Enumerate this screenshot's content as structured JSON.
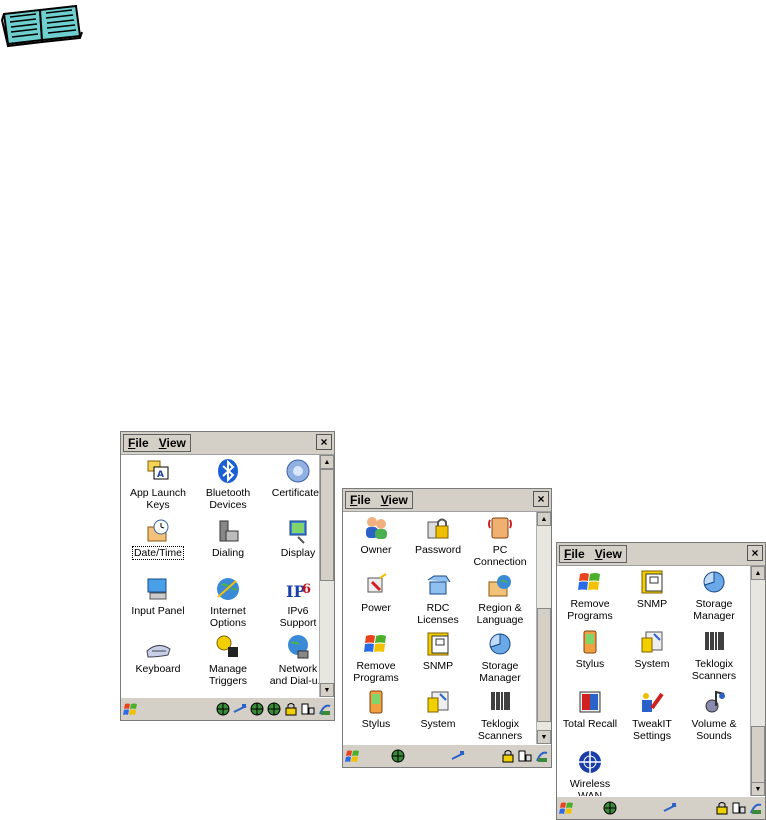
{
  "windows": [
    {
      "menu": {
        "file": "File",
        "view": "View"
      },
      "close": "×",
      "icons": [
        {
          "label": "App Launch\nKeys",
          "icon": "app-launch-keys-icon"
        },
        {
          "label": "Bluetooth\nDevices",
          "icon": "bluetooth-icon"
        },
        {
          "label": "Certificates",
          "icon": "certificates-icon"
        },
        {
          "label": "Date/Time",
          "icon": "clock-icon"
        },
        {
          "label": "Dialing",
          "icon": "dialing-icon"
        },
        {
          "label": "Display",
          "icon": "display-icon"
        },
        {
          "label": "Input Panel",
          "icon": "input-panel-icon"
        },
        {
          "label": "Internet\nOptions",
          "icon": "globe-icon"
        },
        {
          "label": "IPv6\nSupport",
          "icon": "ipv6-icon"
        },
        {
          "label": "Keyboard",
          "icon": "keyboard-icon"
        },
        {
          "label": "Manage\nTriggers",
          "icon": "triggers-icon"
        },
        {
          "label": "Network\nand Dial-u...",
          "icon": "network-icon"
        }
      ]
    },
    {
      "menu": {
        "file": "File",
        "view": "View"
      },
      "close": "×",
      "icons": [
        {
          "label": "Owner",
          "icon": "owner-icon"
        },
        {
          "label": "Password",
          "icon": "password-icon"
        },
        {
          "label": "PC\nConnection",
          "icon": "pc-connection-icon"
        },
        {
          "label": "Power",
          "icon": "power-icon"
        },
        {
          "label": "RDC\nLicenses",
          "icon": "rdc-licenses-icon"
        },
        {
          "label": "Region &\nLanguage",
          "icon": "region-icon"
        },
        {
          "label": "Remove\nPrograms",
          "icon": "remove-programs-icon"
        },
        {
          "label": "SNMP",
          "icon": "snmp-icon"
        },
        {
          "label": "Storage\nManager",
          "icon": "storage-icon"
        },
        {
          "label": "Stylus",
          "icon": "stylus-icon"
        },
        {
          "label": "System",
          "icon": "system-icon"
        },
        {
          "label": "Teklogix\nScanners",
          "icon": "barcode-icon"
        }
      ]
    },
    {
      "menu": {
        "file": "File",
        "view": "View"
      },
      "close": "×",
      "icons": [
        {
          "label": "Remove\nPrograms",
          "icon": "remove-programs-icon"
        },
        {
          "label": "SNMP",
          "icon": "snmp-icon"
        },
        {
          "label": "Storage\nManager",
          "icon": "storage-icon"
        },
        {
          "label": "Stylus",
          "icon": "stylus-icon"
        },
        {
          "label": "System",
          "icon": "system-icon"
        },
        {
          "label": "Teklogix\nScanners",
          "icon": "barcode-icon"
        },
        {
          "label": "Total Recall",
          "icon": "total-recall-icon"
        },
        {
          "label": "TweakIT\nSettings",
          "icon": "tweakit-icon"
        },
        {
          "label": "Volume &\nSounds",
          "icon": "volume-icon"
        },
        {
          "label": "Wireless\nWAN",
          "icon": "wireless-wan-icon"
        }
      ]
    }
  ]
}
